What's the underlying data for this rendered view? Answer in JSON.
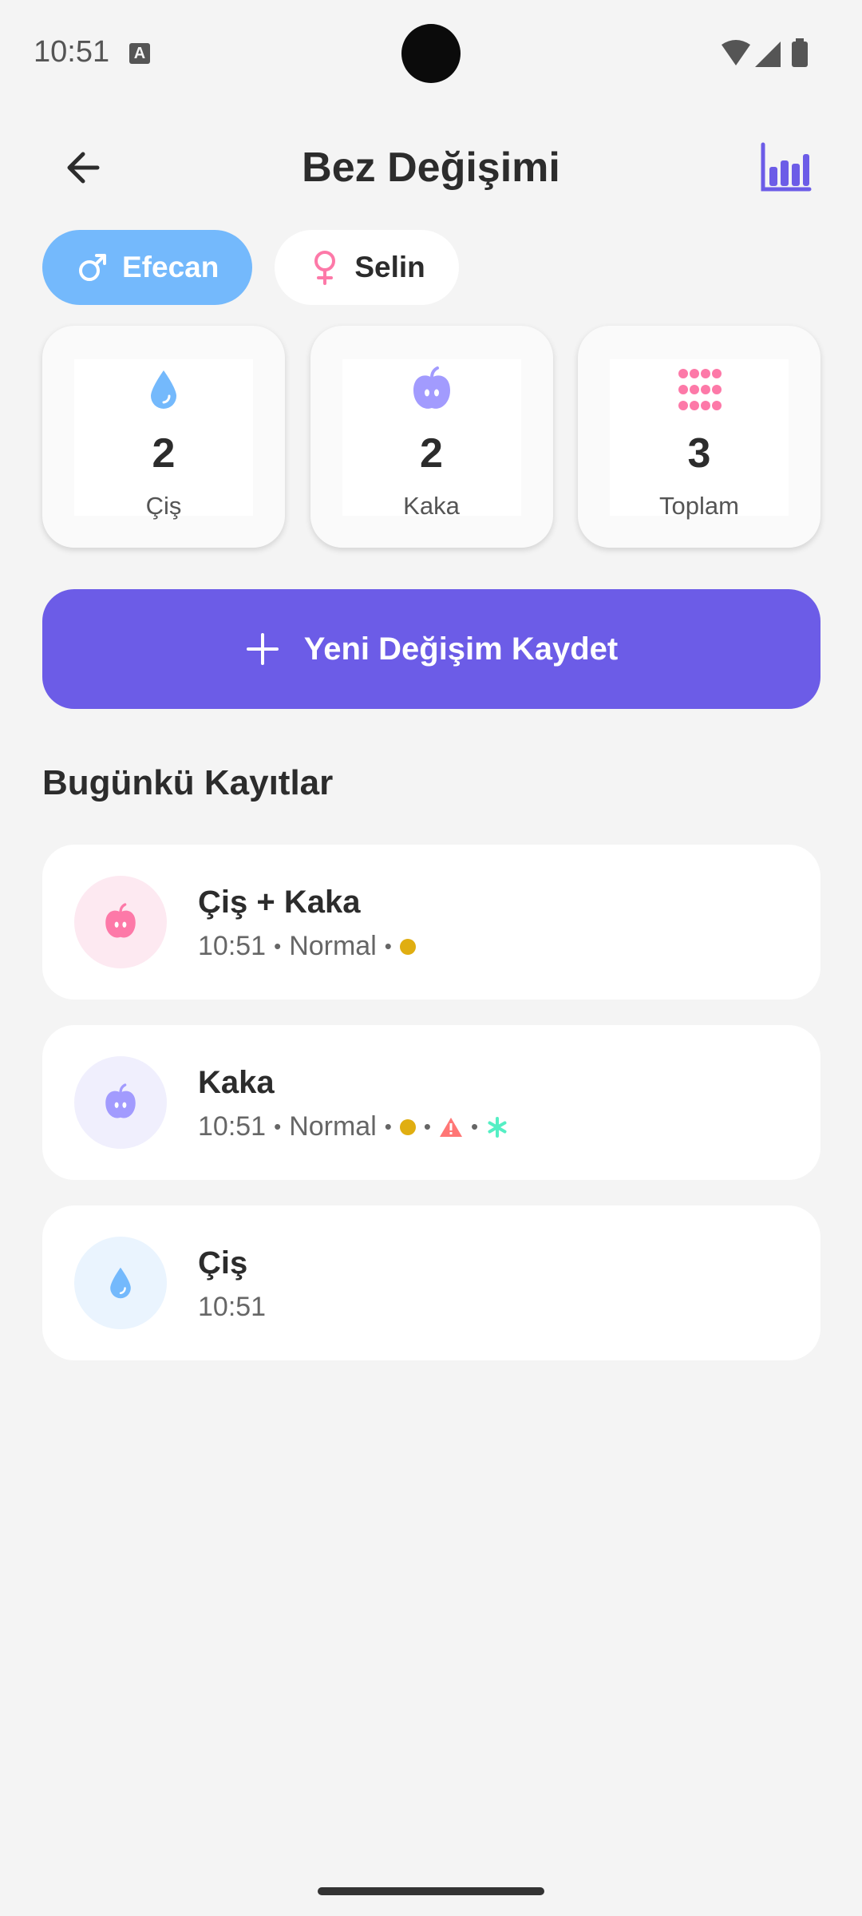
{
  "status_bar": {
    "time": "10:51",
    "notification_glyph": "A"
  },
  "header": {
    "title": "Bez Değişimi",
    "back_icon": "arrow-left-icon",
    "stats_icon": "bar-chart-icon"
  },
  "children": [
    {
      "name": "Efecan",
      "icon": "male-icon",
      "active": true
    },
    {
      "name": "Selin",
      "icon": "female-icon",
      "active": false
    }
  ],
  "stats": [
    {
      "value": "2",
      "label": "Çiş",
      "icon": "droplet-icon"
    },
    {
      "value": "2",
      "label": "Kaka",
      "icon": "poop-icon"
    },
    {
      "value": "3",
      "label": "Toplam",
      "icon": "grid-icon"
    }
  ],
  "new_button": {
    "label": "Yeni Değişim Kaydet"
  },
  "section_title": "Bugünkü Kayıtlar",
  "records": [
    {
      "title": "Çiş + Kaka",
      "time": "10:51",
      "detail": "Normal",
      "badges": [
        "yellow-dot"
      ]
    },
    {
      "title": "Kaka",
      "time": "10:51",
      "detail": "Normal",
      "badges": [
        "yellow-dot",
        "warning-icon",
        "asterisk-icon"
      ]
    },
    {
      "title": "Çiş",
      "time": "10:51"
    }
  ],
  "colors": {
    "accent": "#6c5ce7",
    "active_chip": "#74b9fc",
    "pee_blue": "#74b9fc",
    "poop_purple": "#a29bfe",
    "pink": "#fd79a8",
    "yellow_dot": "#e0ae11",
    "warning_red": "#ff7675",
    "asterisk_teal": "#55efc4"
  }
}
